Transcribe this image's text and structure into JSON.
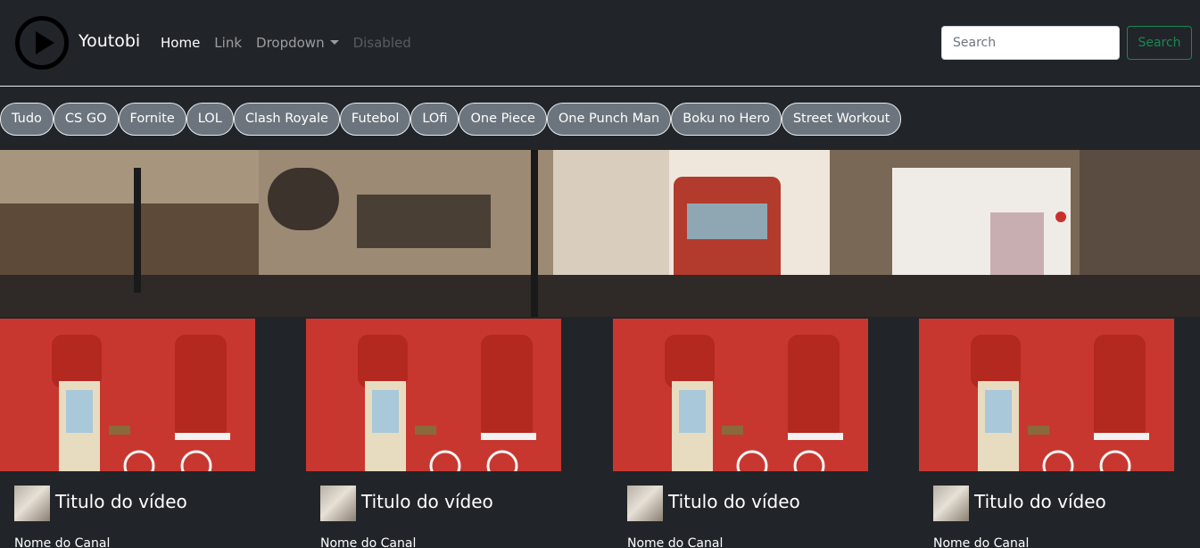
{
  "navbar": {
    "brand": "Youtobi",
    "links": [
      {
        "label": "Home",
        "state": "active"
      },
      {
        "label": "Link",
        "state": "normal"
      },
      {
        "label": "Dropdown",
        "state": "dropdown"
      },
      {
        "label": "Disabled",
        "state": "disabled"
      }
    ],
    "search": {
      "placeholder": "Search",
      "value": "",
      "button_label": "Search"
    }
  },
  "categories": [
    "Tudo",
    "CS GO",
    "Fornite",
    "LOL",
    "Clash Royale",
    "Futebol",
    "LOfi",
    "One Piece",
    "One Punch Man",
    "Boku no Hero",
    "Street Workout"
  ],
  "videos": [
    {
      "title": "Titulo do vídeo",
      "channel": "Nome do Canal"
    },
    {
      "title": "Titulo do vídeo",
      "channel": "Nome do Canal"
    },
    {
      "title": "Titulo do vídeo",
      "channel": "Nome do Canal"
    },
    {
      "title": "Titulo do vídeo",
      "channel": "Nome do Canal"
    }
  ],
  "colors": {
    "background": "#212529",
    "accent_success": "#198754",
    "pill": "#6c757d"
  },
  "icons": {
    "logo": "play-circle-icon",
    "dropdown": "caret-down-icon"
  }
}
